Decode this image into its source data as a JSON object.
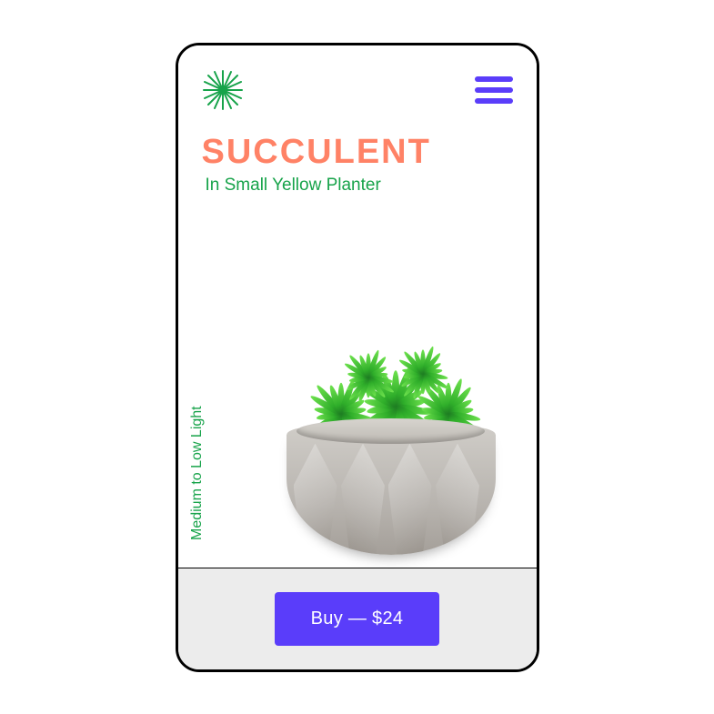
{
  "brand": {
    "color": "#17a34a"
  },
  "menu": {
    "color": "#5a3dfa"
  },
  "product": {
    "title": "SUCCULENT",
    "subtitle": "In Small Yellow Planter",
    "light_requirement": "Medium to Low Light",
    "price_display": "$24",
    "buy_label": "Buy — $24"
  },
  "colors": {
    "title": "#ff8266",
    "accent_text": "#17a34a",
    "button_bg": "#5a3dfa",
    "footer_bg": "#ececec"
  }
}
